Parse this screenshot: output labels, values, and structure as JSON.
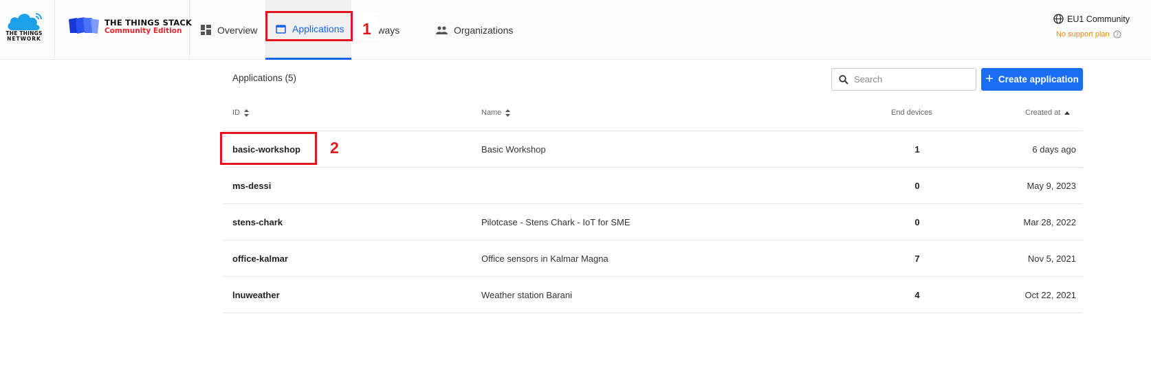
{
  "brand": {
    "ttn_line1": "THE THINGS",
    "ttn_line2": "NETWORK",
    "stack_title": "THE THINGS STACK",
    "stack_subtitle": "Community Edition"
  },
  "nav": {
    "overview": "Overview",
    "applications": "Applications",
    "gateways": "Gateways",
    "organizations": "Organizations"
  },
  "account": {
    "region": "EU1 Community",
    "support_plan": "No support plan"
  },
  "annotations": {
    "step1": "1",
    "step2": "2"
  },
  "page": {
    "title": "Applications (5)",
    "search_placeholder": "Search",
    "create_button": "Create application"
  },
  "table": {
    "columns": {
      "id": "ID",
      "name": "Name",
      "end_devices": "End devices",
      "created_at": "Created at"
    },
    "rows": [
      {
        "id": "basic-workshop",
        "name": "Basic Workshop",
        "end_devices": "1",
        "created_at": "6 days ago"
      },
      {
        "id": "ms-dessi",
        "name": "",
        "end_devices": "0",
        "created_at": "May 9, 2023"
      },
      {
        "id": "stens-chark",
        "name": "Pilotcase - Stens Chark - IoT for SME",
        "end_devices": "0",
        "created_at": "Mar 28, 2022"
      },
      {
        "id": "office-kalmar",
        "name": "Office sensors in Kalmar Magna",
        "end_devices": "7",
        "created_at": "Nov 5, 2021"
      },
      {
        "id": "lnuweather",
        "name": "Weather station Barani",
        "end_devices": "4",
        "created_at": "Oct 22, 2021"
      }
    ]
  },
  "colors": {
    "accent": "#1b6ef3",
    "annotation": "#e3161d",
    "brand_red": "#e0262d",
    "support_orange": "#e28a13"
  },
  "icons": [
    "ttn-cloud-icon",
    "tts-logo-icon",
    "dashboard-icon",
    "window-icon",
    "people-icon",
    "globe-icon",
    "help-circle-icon",
    "search-icon",
    "plus-icon",
    "sort-icon",
    "sort-up-icon"
  ]
}
